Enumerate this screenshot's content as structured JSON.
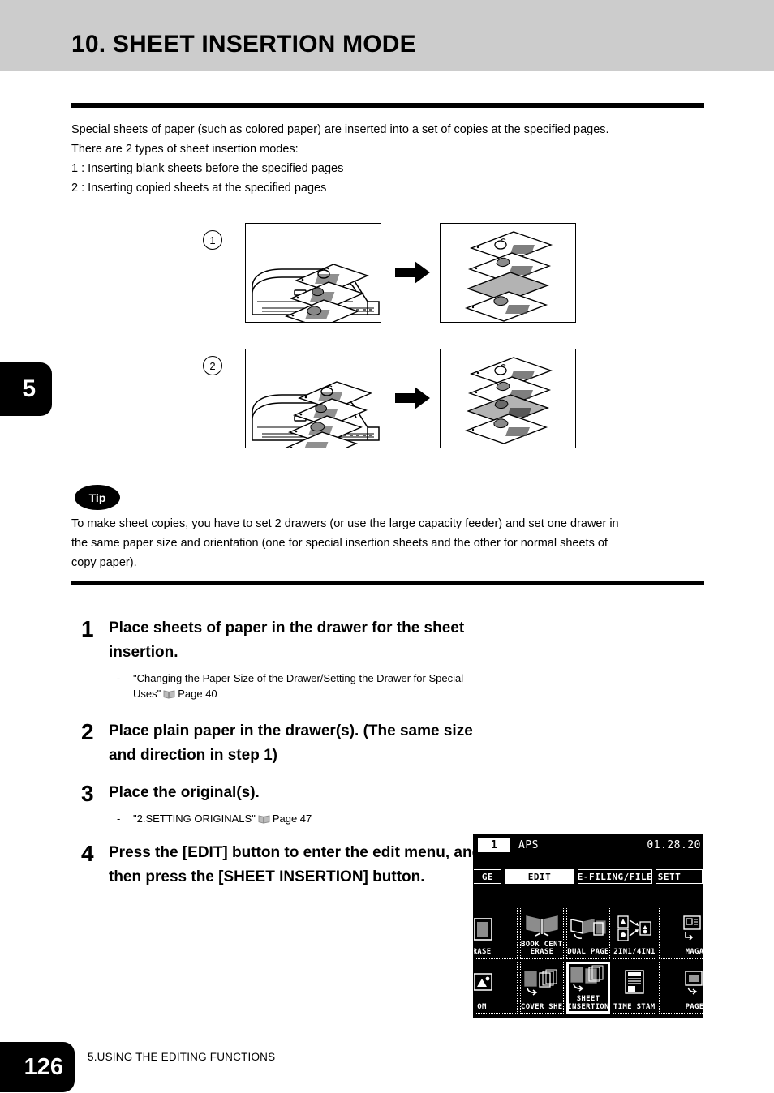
{
  "header": {
    "title": "10. SHEET INSERTION MODE"
  },
  "intro": {
    "line1": "Special sheets of paper (such as colored paper) are inserted into a set of copies at the specified pages.",
    "line2": "There are 2 types of sheet insertion modes:",
    "line3": "1 : Inserting blank sheets before the specified pages",
    "line4": "2 : Inserting copied sheets at the specified pages"
  },
  "chapter_tab": {
    "number": "5"
  },
  "illustrations": [
    {
      "marker": "1",
      "alt_left": "copier-with-originals",
      "alt_right": "output-stack-with-blank-insert"
    },
    {
      "marker": "2",
      "alt_left": "copier-with-originals",
      "alt_right": "output-stack-with-copied-insert"
    }
  ],
  "tip": {
    "badge": "Tip",
    "line1": "To make sheet copies, you have to set 2 drawers (or use the large capacity feeder) and set one drawer in",
    "line2": "the same paper size and orientation (one for special insertion sheets and the other for normal sheets of",
    "line3": "copy paper)."
  },
  "steps": [
    {
      "number": "1",
      "text": "Place sheets of paper in the drawer for the sheet insertion.",
      "note_dash": "-",
      "note_text": "\"Changing the Paper Size of the Drawer/Setting the Drawer for Special Uses\"",
      "note_ref": "Page 40"
    },
    {
      "number": "2",
      "text": "Place plain paper in the drawer(s). (The same size and direction in step 1)",
      "note_dash": "",
      "note_text": "",
      "note_ref": ""
    },
    {
      "number": "3",
      "text": "Place the original(s).",
      "note_dash": "-",
      "note_text": "\"2.SETTING ORIGINALS\"",
      "note_ref": "Page 47"
    },
    {
      "number": "4",
      "text": "Press the [EDIT] button to enter the edit menu, and then press the [SHEET INSERTION] button.",
      "note_dash": "",
      "note_text": "",
      "note_ref": ""
    }
  ],
  "lcd": {
    "copies": "1",
    "paper_mode": "APS",
    "datetime": "01.28.20",
    "tabs": [
      {
        "label": "GE",
        "active": false,
        "clipped": "left"
      },
      {
        "label": "EDIT",
        "active": true,
        "clipped": "none"
      },
      {
        "label": "E-FILING/FILE",
        "active": false,
        "clipped": "none"
      },
      {
        "label": "SETT",
        "active": false,
        "clipped": "right"
      }
    ],
    "buttons": [
      {
        "label": "RASE",
        "icon": "edge-erase-icon",
        "selected": false,
        "clipped": "left"
      },
      {
        "label": "BOOK CENTER\nERASE",
        "icon": "book-center-erase-icon",
        "selected": false,
        "clipped": "none"
      },
      {
        "label": "DUAL  PAGE",
        "icon": "dual-page-icon",
        "selected": false,
        "clipped": "none"
      },
      {
        "label": "2IN1/4IN1",
        "icon": "2in1-4in1-icon",
        "selected": false,
        "clipped": "none"
      },
      {
        "label": "MAGA",
        "icon": "magazine-sort-icon",
        "selected": false,
        "clipped": "right"
      },
      {
        "label": "OM",
        "icon": "image-zoom-icon",
        "selected": false,
        "clipped": "left"
      },
      {
        "label": "COVER SHEET",
        "icon": "cover-sheet-icon",
        "selected": false,
        "clipped": "none"
      },
      {
        "label": "SHEET\nINSERTION",
        "icon": "sheet-insertion-icon",
        "selected": true,
        "clipped": "none"
      },
      {
        "label": "TIME STAMP",
        "icon": "time-stamp-icon",
        "selected": false,
        "clipped": "none"
      },
      {
        "label": "PAGE",
        "icon": "page-number-icon",
        "selected": false,
        "clipped": "right"
      }
    ]
  },
  "footer": {
    "page_number": "126",
    "chapter_title": "5.USING THE EDITING FUNCTIONS"
  },
  "colors": {
    "header_band": "#cccccc",
    "rule": "#000000",
    "insert_sheet_fill": "#b3b3b3",
    "lcd_bg": "#000000",
    "lcd_fg": "#ffffff"
  }
}
